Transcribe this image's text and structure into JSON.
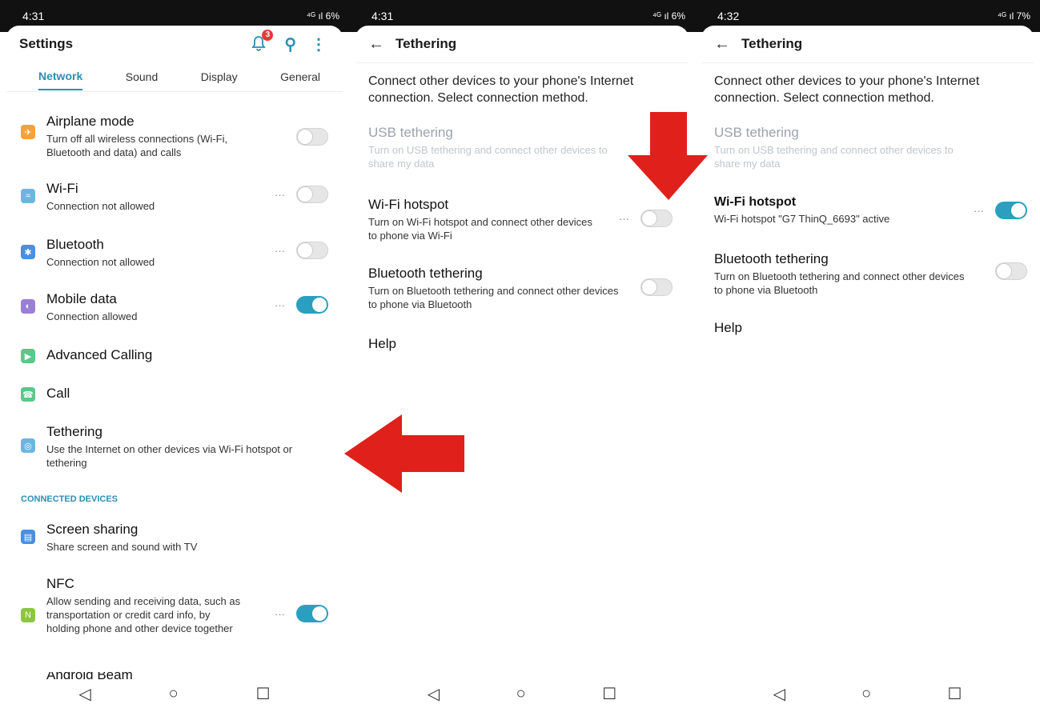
{
  "panel1": {
    "status": {
      "time": "4:31",
      "right": "⁴ᴳ ıl 6%"
    },
    "header": {
      "title": "Settings",
      "badge": "3"
    },
    "tabs": [
      {
        "label": "Network"
      },
      {
        "label": "Sound"
      },
      {
        "label": "Display"
      },
      {
        "label": "General"
      }
    ],
    "items": [
      {
        "title": "Airplane mode",
        "subtitle": "Turn off all wireless connections (Wi-Fi, Bluetooth and data) and calls",
        "toggle": "off"
      },
      {
        "title": "Wi-Fi",
        "subtitle": "Connection not allowed",
        "toggle": "off"
      },
      {
        "title": "Bluetooth",
        "subtitle": "Connection not allowed",
        "toggle": "off"
      },
      {
        "title": "Mobile data",
        "subtitle": "Connection allowed",
        "toggle": "on"
      },
      {
        "title": "Advanced Calling"
      },
      {
        "title": "Call"
      },
      {
        "title": "Tethering",
        "subtitle": "Use the Internet on other devices via Wi-Fi hotspot or tethering"
      }
    ],
    "section": "CONNECTED DEVICES",
    "items2": [
      {
        "title": "Screen sharing",
        "subtitle": "Share screen and sound with TV"
      },
      {
        "title": "NFC",
        "subtitle": "Allow sending and receiving data, such as transportation or credit card info, by holding phone and other device together",
        "toggle": "on"
      },
      {
        "title": "Android Beam"
      }
    ]
  },
  "panel2": {
    "status": {
      "time": "4:31",
      "right": "⁴ᴳ ıl 6%"
    },
    "header": {
      "title": "Tethering"
    },
    "description": "Connect other devices to your phone's Internet connection. Select connection method.",
    "items": [
      {
        "title": "USB tethering",
        "subtitle": "Turn on USB tethering and connect other devices to share my data"
      },
      {
        "title": "Wi-Fi hotspot",
        "subtitle": "Turn on Wi-Fi hotspot and connect other devices to phone via Wi-Fi",
        "toggle": "off"
      },
      {
        "title": "Bluetooth tethering",
        "subtitle": "Turn on Bluetooth tethering and connect other devices to phone via Bluetooth",
        "toggle": "off"
      }
    ],
    "help": "Help"
  },
  "panel3": {
    "status": {
      "time": "4:32",
      "right": "⁴ᴳ ıl 7%"
    },
    "header": {
      "title": "Tethering"
    },
    "description": "Connect other devices to your phone's Internet connection. Select connection method.",
    "items": [
      {
        "title": "USB tethering",
        "subtitle": "Turn on USB tethering and connect other devices to share my data"
      },
      {
        "title": "Wi-Fi hotspot",
        "subtitle": "Wi-Fi hotspot \"G7 ThinQ_6693\" active",
        "toggle": "on"
      },
      {
        "title": "Bluetooth tethering",
        "subtitle": "Turn on Bluetooth tethering and connect other devices to phone via Bluetooth",
        "toggle": "off"
      }
    ],
    "help": "Help"
  },
  "nav": {
    "back": "◁",
    "home": "○",
    "recents": "☐"
  },
  "colors": {
    "accent": "#2a8fb3",
    "toggle_on": "#2a9fc0",
    "arrow": "#e0201b"
  }
}
